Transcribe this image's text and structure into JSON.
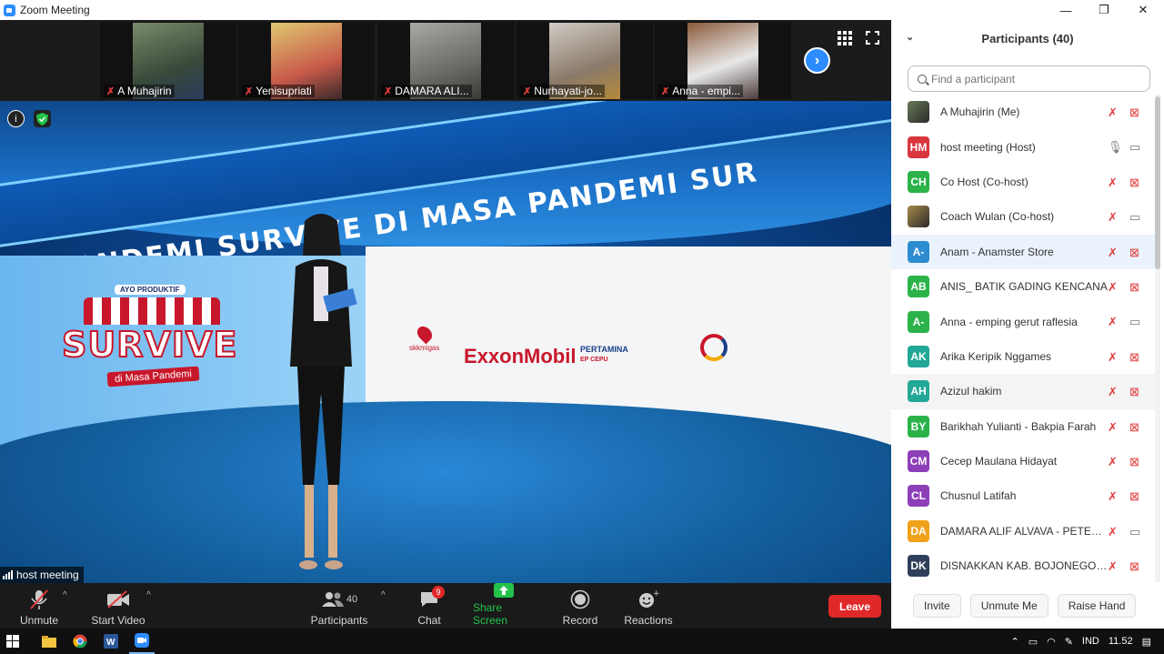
{
  "window": {
    "title": "Zoom Meeting",
    "minimize": "—",
    "restore": "❐",
    "close": "✕"
  },
  "strip": {
    "participants": [
      {
        "name": "A Muhajirin",
        "bg": "#5a6b4a"
      },
      {
        "name": "Yenisupriati",
        "bg": "#d8c06a"
      },
      {
        "name": "DAMARA ALI...",
        "bg": "#8a8a88"
      },
      {
        "name": "Nurhayati-jo...",
        "bg": "#b9b4ad"
      },
      {
        "name": "Anna - empi...",
        "bg": "#6b4a3a"
      }
    ]
  },
  "stage": {
    "banner_text": "SA PANDEMI    SURVIVE DI MASA PANDEMI    SUR",
    "survive_tag": "AYO PRODUKTIF",
    "survive_word": "SURVIVE",
    "survive_sub": "di Masa Pandemi",
    "logo_skk": "skkmigas",
    "logo_exxon": "ExxonMobil",
    "logo_pertamina": "PERTAMINA",
    "logo_pertamina_sub": "EP CEPU",
    "speaker": "host meeting"
  },
  "toolbar": {
    "unmute": "Unmute",
    "start_video": "Start Video",
    "participants": "Participants",
    "participants_count": "40",
    "chat": "Chat",
    "chat_badge": "9",
    "share_screen": "Share Screen",
    "record": "Record",
    "reactions": "Reactions",
    "leave": "Leave"
  },
  "panel": {
    "title": "Participants (40)",
    "search_placeholder": "Find a participant",
    "participants": [
      {
        "initials": "",
        "name": "A Muhajirin (Me)",
        "color": "#6a7a5a",
        "photo": true,
        "mic": "muted",
        "video": "off"
      },
      {
        "initials": "HM",
        "name": "host meeting (Host)",
        "color": "#d9363e",
        "mic": "on",
        "video": "on"
      },
      {
        "initials": "CH",
        "name": "Co Host (Co-host)",
        "color": "#2bb34a",
        "mic": "muted",
        "video": "off"
      },
      {
        "initials": "",
        "name": "Coach Wulan (Co-host)",
        "color": "#a88a4a",
        "photo": true,
        "mic": "muted",
        "video": "on"
      },
      {
        "initials": "A-",
        "name": "Anam - Anamster Store",
        "color": "#2d8ccf",
        "mic": "muted",
        "video": "off"
      },
      {
        "initials": "AB",
        "name": "ANIS_ BATIK GADING KENCANA",
        "color": "#2bb34a",
        "mic": "muted",
        "video": "off"
      },
      {
        "initials": "A-",
        "name": "Anna - emping gerut raflesia",
        "color": "#2bb34a",
        "mic": "muted",
        "video": "on"
      },
      {
        "initials": "AK",
        "name": "Arika Keripik Nggames",
        "color": "#22a897",
        "mic": "muted",
        "video": "off"
      },
      {
        "initials": "AH",
        "name": "Azizul hakim",
        "color": "#22a897",
        "mic": "muted",
        "video": "off"
      },
      {
        "initials": "BY",
        "name": "Barikhah Yulianti - Bakpia Farah",
        "color": "#2bb34a",
        "mic": "muted",
        "video": "off"
      },
      {
        "initials": "CM",
        "name": "Cecep Maulana Hidayat",
        "color": "#8d3fb8",
        "mic": "muted",
        "video": "off"
      },
      {
        "initials": "CL",
        "name": "Chusnul Latifah",
        "color": "#8d3fb8",
        "mic": "muted",
        "video": "off"
      },
      {
        "initials": "DA",
        "name": "DAMARA ALIF ALVAVA - PETERN...",
        "color": "#f0a21b",
        "mic": "muted",
        "video": "on"
      },
      {
        "initials": "DK",
        "name": "DISNAKKAN KAB. BOJONEGORO",
        "color": "#2f3f5a",
        "mic": "muted",
        "video": "off"
      }
    ],
    "footer": {
      "invite": "Invite",
      "unmute_me": "Unmute Me",
      "raise_hand": "Raise Hand"
    }
  },
  "taskbar": {
    "lang": "IND",
    "time": "11.52"
  }
}
